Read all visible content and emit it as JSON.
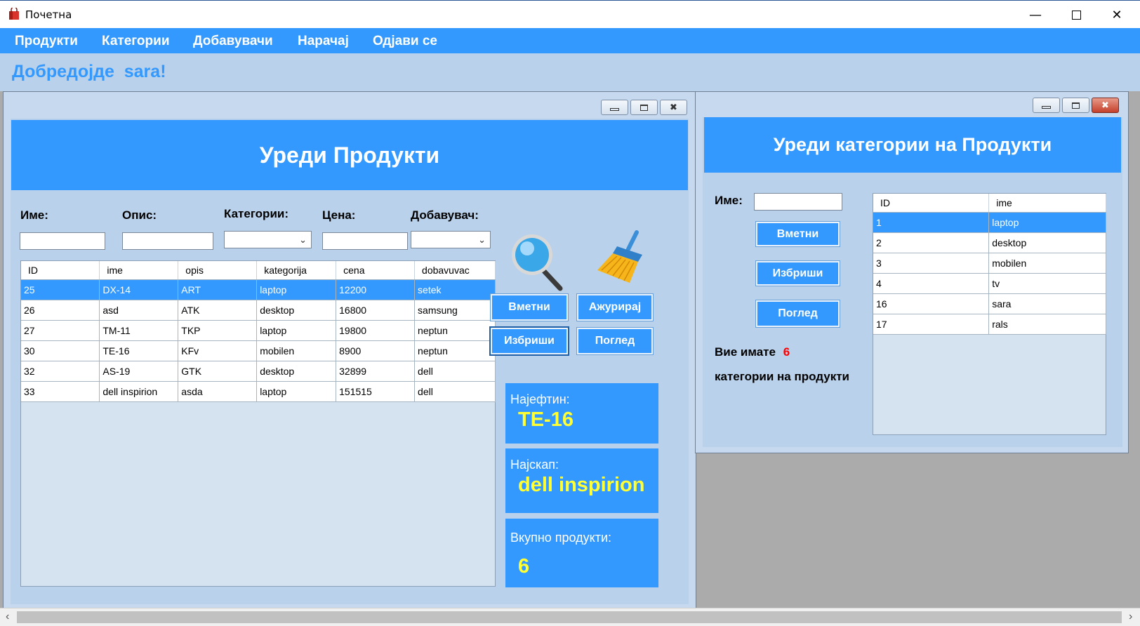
{
  "window": {
    "title": "Почетна"
  },
  "menu": [
    "Продукти",
    "Категории",
    "Добавувачи",
    "Нарачај",
    "Одјави се"
  ],
  "welcome": "Добредојде  sara!",
  "products_form": {
    "header": "Уреди Продукти",
    "labels": {
      "ime": "Име:",
      "opis": "Опис:",
      "kategorii": "Категории:",
      "cena": "Цена:",
      "dobavuvac": "Добавувач:"
    },
    "columns": [
      "ID",
      "ime",
      "opis",
      "kategorija",
      "cena",
      "dobavuvac"
    ],
    "rows": [
      [
        "25",
        "DX-14",
        "ART",
        "laptop",
        "12200",
        "setek"
      ],
      [
        "26",
        "asd",
        "ATK",
        "desktop",
        "16800",
        "samsung"
      ],
      [
        "27",
        "TM-11",
        "TKP",
        "laptop",
        "19800",
        "neptun"
      ],
      [
        "30",
        "TE-16",
        "KFv",
        "mobilen",
        "8900",
        "neptun"
      ],
      [
        "32",
        "AS-19",
        "GTK",
        "desktop",
        "32899",
        "dell"
      ],
      [
        "33",
        "dell inspirion",
        "asda",
        "laptop",
        "151515",
        "dell"
      ]
    ],
    "selected_row": 0,
    "buttons": {
      "insert": "Вметни",
      "update": "Ажурирај",
      "delete": "Избриши",
      "view": "Поглед"
    },
    "icons": {
      "search": "magnifier-icon",
      "clear": "broom-icon"
    },
    "stats": {
      "cheapest_label": "Најефтин:",
      "cheapest_value": "TE-16",
      "expensive_label": "Најскап:",
      "expensive_value": "dell inspirion",
      "total_label": "Вкупно продукти:",
      "total_value": "6"
    }
  },
  "categories_form": {
    "header": "Уреди категории на Продукти",
    "label_ime": "Име:",
    "buttons": {
      "insert": "Вметни",
      "delete": "Избриши",
      "view": "Поглед"
    },
    "columns": [
      "ID",
      "ime"
    ],
    "rows": [
      [
        "1",
        "laptop"
      ],
      [
        "2",
        "desktop"
      ],
      [
        "3",
        "mobilen"
      ],
      [
        "4",
        "tv"
      ],
      [
        "16",
        "sara"
      ],
      [
        "17",
        "rals"
      ]
    ],
    "selected_row": 0,
    "count_prefix": "Вие имате",
    "count_value": "6",
    "count_suffix": "категории на продукти"
  },
  "colors": {
    "accent": "#3399ff",
    "background": "#b9d1ea",
    "stat_value": "#ffff33",
    "count": "#ff0000"
  }
}
